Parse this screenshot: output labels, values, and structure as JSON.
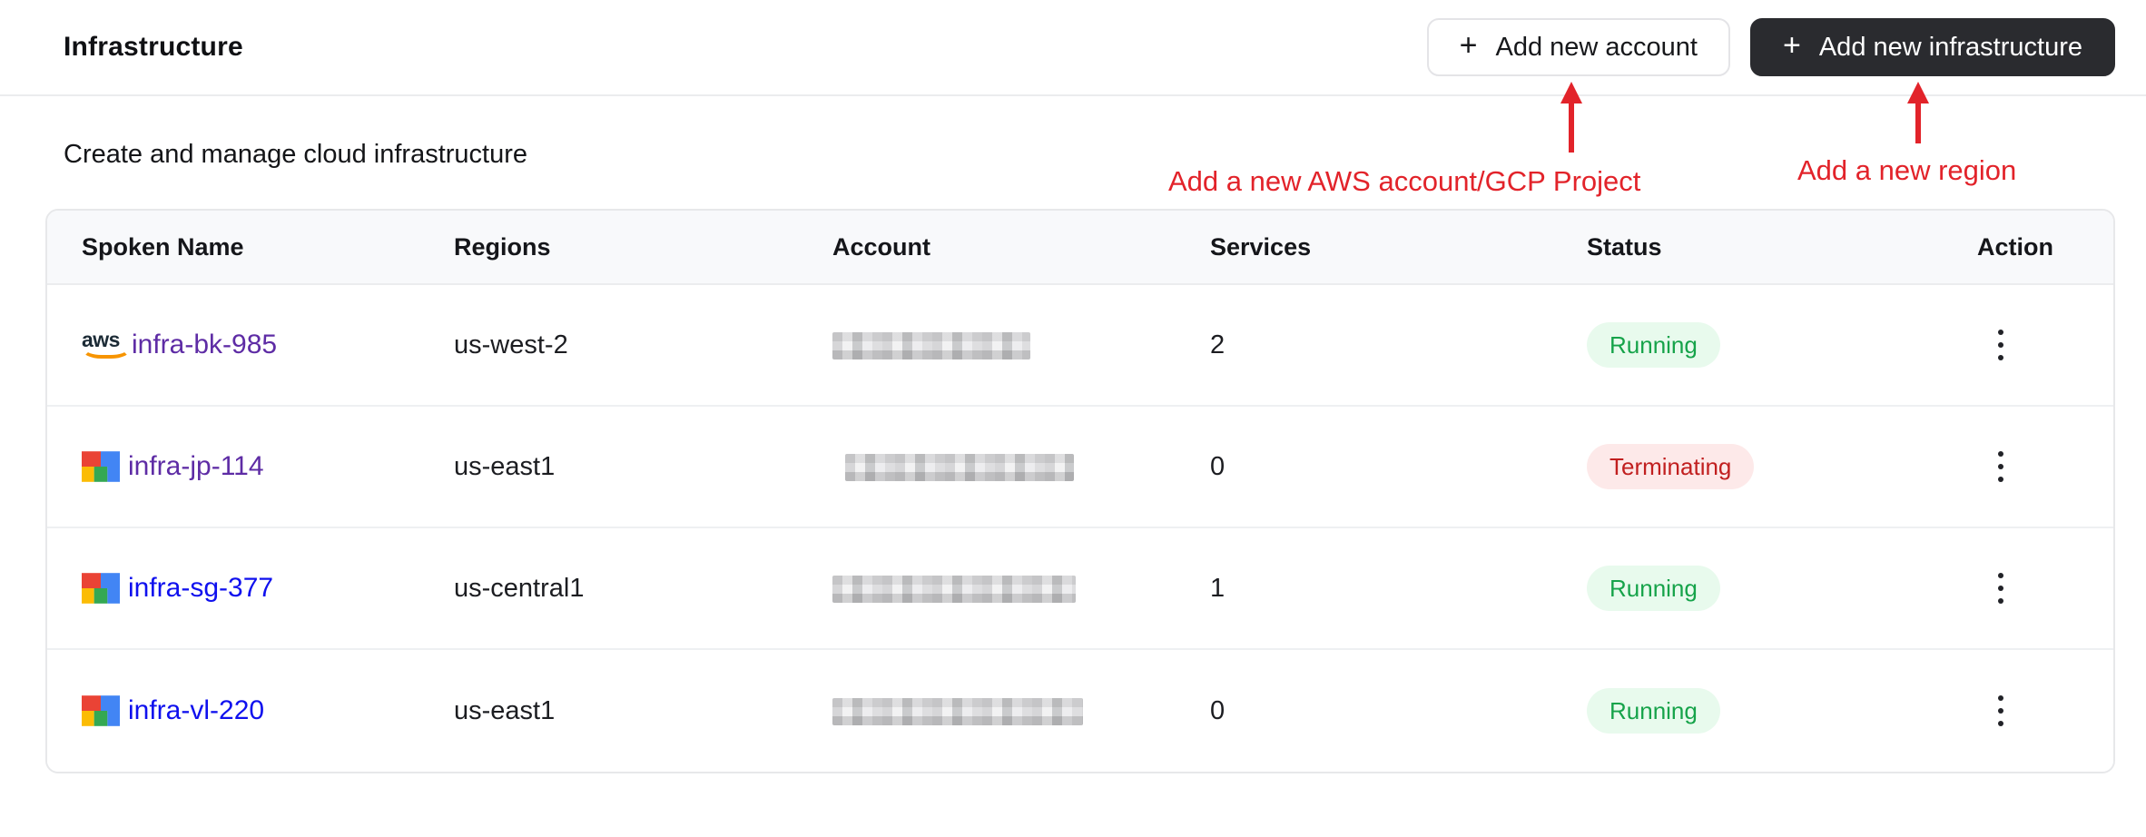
{
  "header": {
    "title": "Infrastructure",
    "buttons": [
      {
        "label": "Add new account",
        "icon": "plus-icon",
        "style": "light"
      },
      {
        "label": "Add new infrastructure",
        "icon": "plus-icon",
        "style": "dark"
      }
    ]
  },
  "subtitle": "Create and manage cloud infrastructure",
  "annotations": {
    "account_note": "Add a new AWS account/GCP Project",
    "region_note": "Add a new region",
    "color": "#e2232a"
  },
  "icons": {
    "aws_label": "aws",
    "kebab": "vertical-three-dots"
  },
  "colors": {
    "dark_button_bg": "#2a2b2f",
    "link": "#0f10ee",
    "link_visited": "#5e2ca5",
    "badge_running_bg": "#e8faed",
    "badge_running_text": "#16a34a",
    "badge_terminating_bg": "#fde9e9",
    "badge_terminating_text": "#c11f1f",
    "table_header_bg": "#f8f9fb"
  },
  "table": {
    "columns": [
      "Spoken Name",
      "Regions",
      "Account",
      "Services",
      "Status",
      "Action"
    ],
    "rows": [
      {
        "name": "infra-bk-985",
        "provider": "aws",
        "visited": true,
        "region": "us-west-2",
        "account_redacted": true,
        "services": "2",
        "status": "Running"
      },
      {
        "name": "infra-jp-114",
        "provider": "gcp",
        "visited": true,
        "region": "us-east1",
        "account_redacted": true,
        "services": "0",
        "status": "Terminating"
      },
      {
        "name": "infra-sg-377",
        "provider": "gcp",
        "visited": false,
        "region": "us-central1",
        "account_redacted": true,
        "services": "1",
        "status": "Running"
      },
      {
        "name": "infra-vl-220",
        "provider": "gcp",
        "visited": false,
        "region": "us-east1",
        "account_redacted": true,
        "services": "0",
        "status": "Running"
      }
    ]
  }
}
